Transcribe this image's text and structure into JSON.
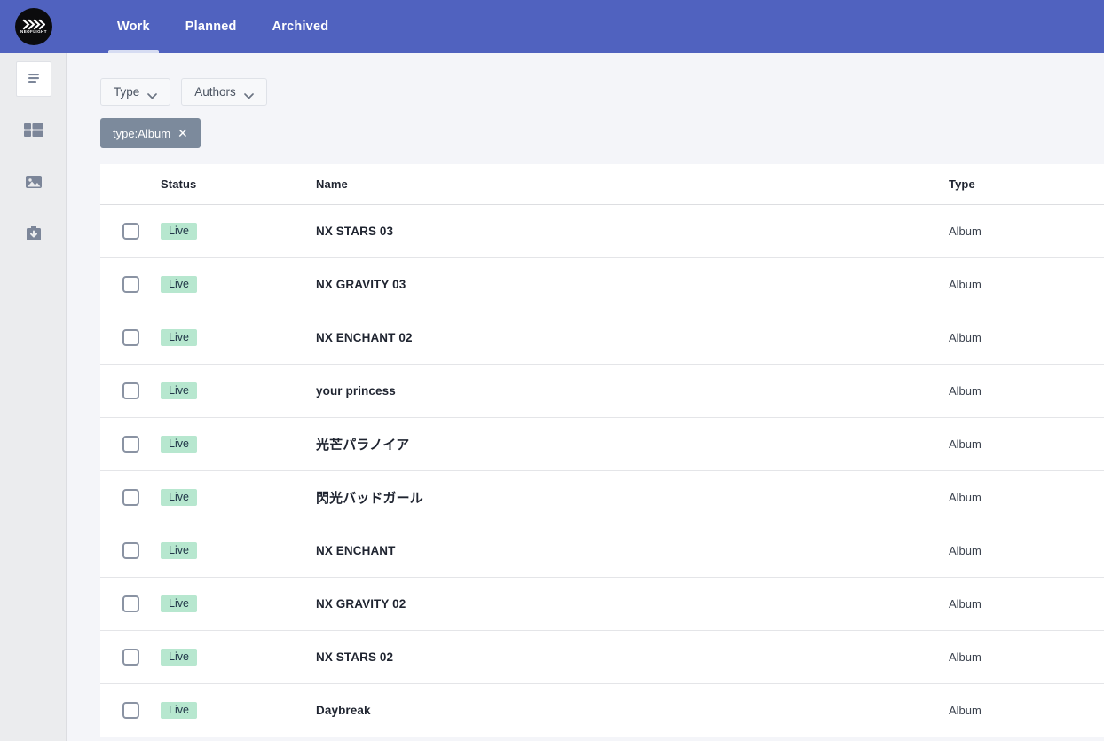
{
  "header": {
    "logo": {
      "icon": "chevrons-logo-icon",
      "wordmark": "NEOFLIGHT"
    },
    "tabs": [
      {
        "label": "Work",
        "active": true
      },
      {
        "label": "Planned",
        "active": false
      },
      {
        "label": "Archived",
        "active": false
      }
    ],
    "background_color": "#5062bf",
    "active_underline_color": "#d6dcf2"
  },
  "sidebar": {
    "items": [
      {
        "icon": "document-list-icon",
        "selected": true
      },
      {
        "icon": "table-layout-icon",
        "selected": false
      },
      {
        "icon": "image-icon",
        "selected": false
      },
      {
        "icon": "archive-download-icon",
        "selected": false
      }
    ],
    "background_color": "#ebecee"
  },
  "filters": {
    "buttons": [
      {
        "label": "Type",
        "icon": "chevron-down-icon"
      },
      {
        "label": "Authors",
        "icon": "chevron-down-icon"
      }
    ],
    "chips": [
      {
        "label": "type:Album",
        "remove_icon": "close-icon",
        "color": "#7c8a9c"
      }
    ]
  },
  "table": {
    "columns": [
      "Status",
      "Name",
      "Type"
    ],
    "status_badge_color": "#b7e7cf",
    "rows": [
      {
        "checked": false,
        "status": "Live",
        "name": "NX STARS 03",
        "type": "Album",
        "jp": false
      },
      {
        "checked": false,
        "status": "Live",
        "name": "NX GRAVITY 03",
        "type": "Album",
        "jp": false
      },
      {
        "checked": false,
        "status": "Live",
        "name": "NX ENCHANT 02",
        "type": "Album",
        "jp": false
      },
      {
        "checked": false,
        "status": "Live",
        "name": "your princess",
        "type": "Album",
        "jp": false
      },
      {
        "checked": false,
        "status": "Live",
        "name": "光芒パラノイア",
        "type": "Album",
        "jp": true
      },
      {
        "checked": false,
        "status": "Live",
        "name": "閃光バッドガール",
        "type": "Album",
        "jp": true
      },
      {
        "checked": false,
        "status": "Live",
        "name": "NX ENCHANT",
        "type": "Album",
        "jp": false
      },
      {
        "checked": false,
        "status": "Live",
        "name": "NX GRAVITY 02",
        "type": "Album",
        "jp": false
      },
      {
        "checked": false,
        "status": "Live",
        "name": "NX STARS 02",
        "type": "Album",
        "jp": false
      },
      {
        "checked": false,
        "status": "Live",
        "name": "Daybreak",
        "type": "Album",
        "jp": false
      }
    ]
  }
}
